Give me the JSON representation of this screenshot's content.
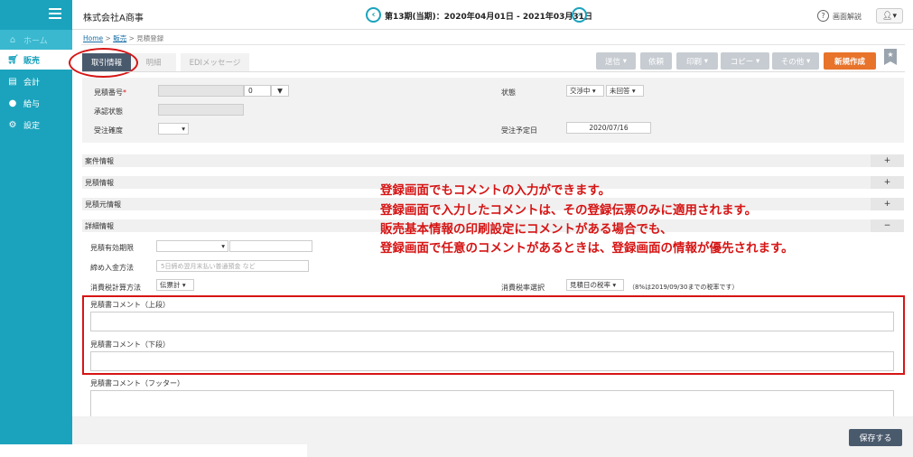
{
  "sidebar": {
    "items": [
      {
        "label": "ホーム",
        "icon": "home-icon"
      },
      {
        "label": "販売",
        "icon": "cart-icon"
      },
      {
        "label": "会計",
        "icon": "ledger-icon"
      },
      {
        "label": "給与",
        "icon": "money-bag-icon"
      },
      {
        "label": "設定",
        "icon": "gear-icon"
      }
    ]
  },
  "header": {
    "company": "株式会社A商事",
    "period": "第13期(当期)：2020年04月01日 - 2021年03月31日",
    "help": "画面解説"
  },
  "breadcrumb": {
    "home": "Home",
    "sales": "販売",
    "current": "見積登録"
  },
  "tabs": [
    "取引情報",
    "明細",
    "EDIメッセージ"
  ],
  "toolbar": {
    "send": "送信",
    "request": "依頼",
    "print": "印刷",
    "copy": "コピー",
    "other": "その他",
    "new": "新規作成"
  },
  "form": {
    "estimate_no_label": "見積番号",
    "estimate_no_value": "0",
    "approval_label": "承認状態",
    "accuracy_label": "受注確度",
    "status_label": "状態",
    "status_value1": "交渉中",
    "status_value2": "未回答",
    "order_date_label": "受注予定日",
    "order_date_value": "2020/07/16"
  },
  "sections": {
    "project": "案件情報",
    "estimate": "見積情報",
    "source": "見積元情報",
    "detail": "詳細情報",
    "expand": "+",
    "collapse": "−"
  },
  "detail": {
    "valid_label": "見積有効期限",
    "payment_label": "締め入金方法",
    "payment_placeholder": "5日締め翌月末払い普通預金 など",
    "tax_calc_label": "消費税計算方法",
    "tax_calc_value": "伝票計",
    "tax_rate_label": "消費税率選択",
    "tax_rate_value": "見積日の税率",
    "tax_rate_note": "（8%は2019/09/30までの税率です）"
  },
  "comments": {
    "upper": "見積書コメント（上段）",
    "lower": "見積書コメント（下段）",
    "footer": "見積書コメント（フッター）"
  },
  "note": {
    "line1": "登録画面でもコメントの入力ができます。",
    "line2": "登録画面で入力したコメントは、その登録伝票のみに適用されます。",
    "line3": "販売基本情報の印刷設定にコメントがある場合でも、",
    "line4": "登録画面で任意のコメントがあるときは、登録画面の情報が優先されます。"
  },
  "footer": {
    "save": "保存する"
  },
  "colors": {
    "sidebar": "#1ba3bd",
    "primary": "#4a5a6d",
    "accent": "#e8732a",
    "annotation": "#d61515"
  }
}
